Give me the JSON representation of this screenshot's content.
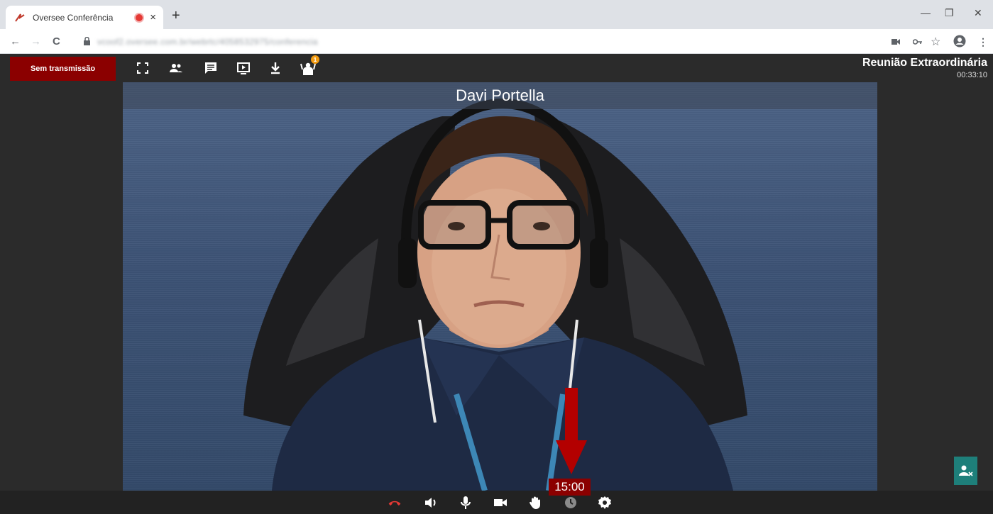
{
  "browser": {
    "tab_title": "Oversee Conferência",
    "tab_close": "×",
    "new_tab": "+",
    "url": "vcoof2.oversee.com.br/webrtc/4058532975/conferencia",
    "window_minimize": "—",
    "window_restore": "❐",
    "window_close": "✕",
    "back": "←",
    "forward": "→",
    "reload": "C",
    "menu": "⋮"
  },
  "app": {
    "broadcast_button": "Sem transmissão",
    "raised_hands_count": "1",
    "meeting_title": "Reunião Extraordinária",
    "meeting_elapsed": "00:33:10",
    "participant_name": "Davi Portella",
    "speaking_timer": "15:00"
  },
  "colors": {
    "accent_red": "#8b0000",
    "hangup_red": "#e53935",
    "teal": "#1e7f7a",
    "badge_orange": "#f39c12"
  },
  "icons": [
    "fullscreen-icon",
    "participants-icon",
    "chat-icon",
    "share-screen-icon",
    "download-icon",
    "raise-hand-queue-icon",
    "hangup-icon",
    "speaker-icon",
    "microphone-icon",
    "camera-icon",
    "hand-icon",
    "clock-icon",
    "settings-icon",
    "remove-user-icon"
  ]
}
